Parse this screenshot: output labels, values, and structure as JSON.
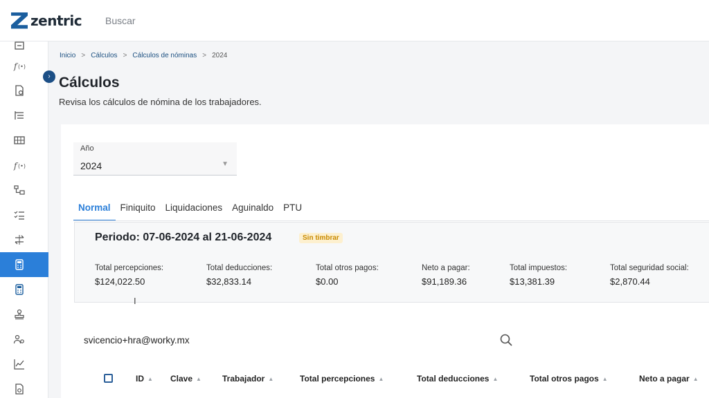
{
  "app": {
    "brand": "zentric",
    "search_placeholder": "Buscar"
  },
  "colors": {
    "accent": "#2b7fd9",
    "brand": "#1b5e9e",
    "badge_text": "#c88a00",
    "badge_bg": "#fdf0cf"
  },
  "sidebar": {
    "items": [
      {
        "icon": "box-icon"
      },
      {
        "icon": "function-icon"
      },
      {
        "icon": "document-settings-icon"
      },
      {
        "icon": "list-tree-icon"
      },
      {
        "icon": "table-grid-icon"
      },
      {
        "icon": "function-icon"
      },
      {
        "icon": "folder-tree-icon"
      },
      {
        "icon": "checklist-icon"
      },
      {
        "icon": "transfer-icon"
      },
      {
        "icon": "calculator-icon",
        "active": true
      },
      {
        "icon": "calculator-icon"
      },
      {
        "icon": "stamp-icon"
      },
      {
        "icon": "users-settings-icon"
      },
      {
        "icon": "chart-line-icon"
      },
      {
        "icon": "file-settings-icon"
      }
    ]
  },
  "breadcrumb": {
    "items": [
      "Inicio",
      "Cálculos",
      "Cálculos de nóminas"
    ],
    "current": "2024",
    "separator": ">"
  },
  "page": {
    "title": "Cálculos",
    "subtitle": "Revisa los cálculos de nómina de los trabajadores."
  },
  "year_select": {
    "label": "Año",
    "value": "2024"
  },
  "tabs": [
    {
      "label": "Normal",
      "active": true
    },
    {
      "label": "Finiquito"
    },
    {
      "label": "Liquidaciones"
    },
    {
      "label": "Aguinaldo"
    },
    {
      "label": "PTU"
    }
  ],
  "period": {
    "title": "Periodo: 07-06-2024 al 21-06-2024",
    "status": "Sin timbrar",
    "metrics": [
      {
        "label": "Total percepciones:",
        "value": "$124,022.50"
      },
      {
        "label": "Total deducciones:",
        "value": "$32,833.14"
      },
      {
        "label": "Total otros pagos:",
        "value": "$0.00"
      },
      {
        "label": "Neto a pagar:",
        "value": "$91,189.36"
      },
      {
        "label": "Total impuestos:",
        "value": "$13,381.39"
      },
      {
        "label": "Total seguridad social:",
        "value": "$2,870.44"
      }
    ]
  },
  "search": {
    "value": "svicencio+hra@worky.mx"
  },
  "table": {
    "columns": [
      "ID",
      "Clave",
      "Trabajador",
      "Total percepciones",
      "Total deducciones",
      "Total otros pagos",
      "Neto a pagar"
    ]
  }
}
